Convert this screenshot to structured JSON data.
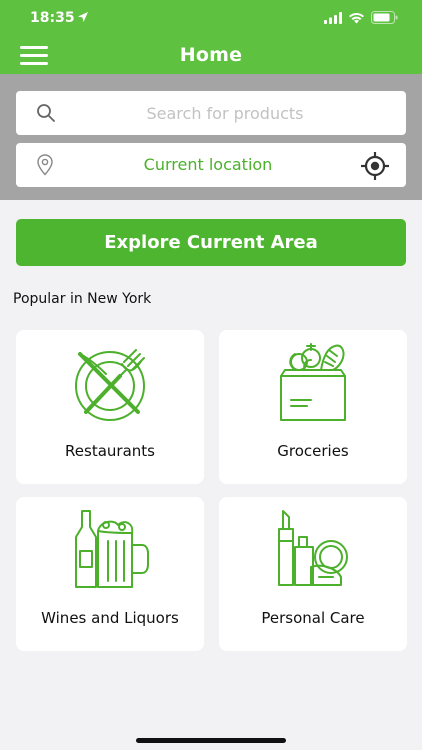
{
  "status_bar": {
    "time": "18:35"
  },
  "header": {
    "title": "Home",
    "menu_icon": "hamburger-menu-icon"
  },
  "search": {
    "placeholder": "Search for products",
    "value": ""
  },
  "location": {
    "label": "Current location"
  },
  "explore_button": {
    "label": "Explore Current Area"
  },
  "popular": {
    "title": "Popular in New York",
    "categories": [
      {
        "label": "Restaurants",
        "icon": "plate-fork-knife-icon"
      },
      {
        "label": "Groceries",
        "icon": "grocery-bag-icon"
      },
      {
        "label": "Wines and Liquors",
        "icon": "bottle-beer-icon"
      },
      {
        "label": "Personal Care",
        "icon": "cosmetics-icon"
      }
    ]
  },
  "colors": {
    "brand_green": "#5ec13f",
    "button_green": "#4db52f",
    "location_text": "#4cb02c",
    "panel_gray": "#a4a4a4"
  }
}
